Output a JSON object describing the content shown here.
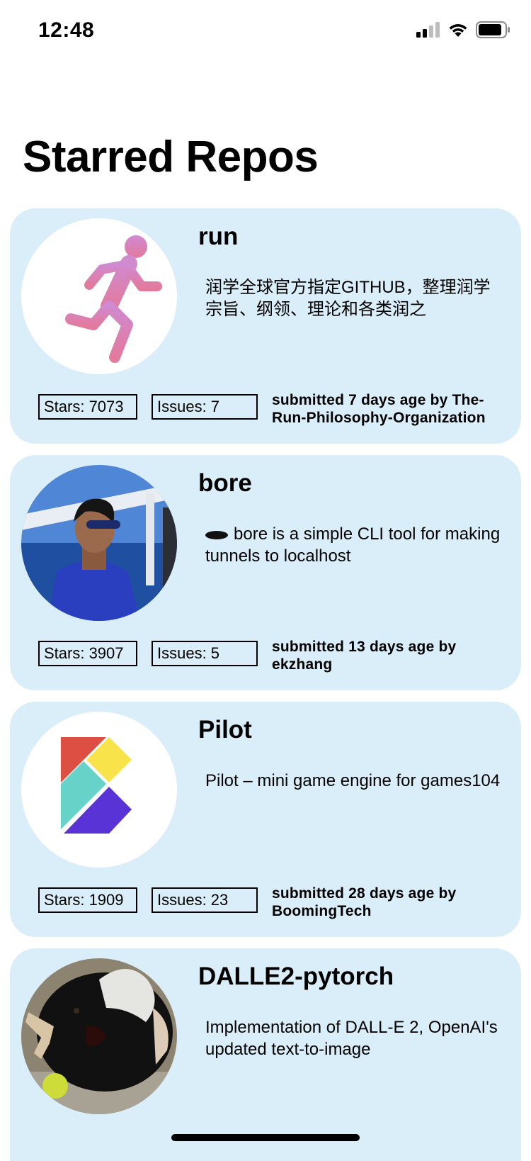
{
  "status_bar": {
    "time": "12:48",
    "icons": [
      "cellular-signal-icon",
      "wifi-icon",
      "battery-icon"
    ]
  },
  "page": {
    "title": "Starred Repos"
  },
  "repos": [
    {
      "name": "run",
      "description": "润学全球官方指定GITHUB，整理润学宗旨、纲领、理论和各类润之",
      "stars_label": "Stars: 7073",
      "issues_label": "Issues: 7",
      "submitted": "submitted 7 days age by The-Run-Philosophy-Organization",
      "avatar_icon": "running-man-icon"
    },
    {
      "name": "bore",
      "description": "bore is a simple CLI tool for making tunnels to localhost",
      "description_emoji": "hole-emoji",
      "stars_label": "Stars: 3907",
      "issues_label": "Issues: 5",
      "submitted": "submitted 13 days age by ekzhang",
      "avatar_icon": "user-photo-avatar"
    },
    {
      "name": "Pilot",
      "description": "Pilot – mini game engine for games104",
      "stars_label": "Stars: 1909",
      "issues_label": "Issues: 23",
      "submitted": "submitted 28 days age by BoomingTech",
      "avatar_icon": "booming-tech-logo-icon"
    },
    {
      "name": "DALLE2-pytorch",
      "description": "Implementation of DALL-E 2, OpenAI's updated text-to-image",
      "avatar_icon": "dog-photo-avatar"
    }
  ],
  "colors": {
    "card_background": "#daeef9",
    "run_icon_gradient": [
      "#d08ad0",
      "#e27a9e"
    ],
    "pilot_logo": [
      "#dd4f43",
      "#f9e34a",
      "#66d2c8",
      "#5a33d6"
    ]
  }
}
